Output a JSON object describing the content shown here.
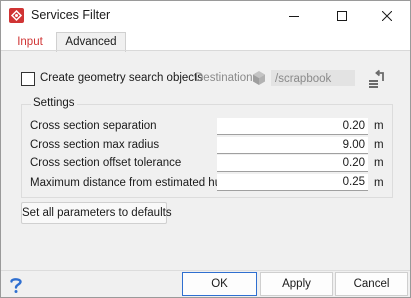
{
  "window": {
    "title": "Services Filter"
  },
  "tabs": [
    {
      "label": "Input"
    },
    {
      "label": "Advanced"
    }
  ],
  "geometry": {
    "checkbox_label": "Create geometry search objects",
    "destination_label": "Destination",
    "destination_value": "/scrapbook",
    "checked": false
  },
  "settings": {
    "title": "Settings",
    "params": [
      {
        "label": "Cross section separation",
        "value": "0.20",
        "unit": "m"
      },
      {
        "label": "Cross section max radius",
        "value": "9.00",
        "unit": "m"
      },
      {
        "label": "Cross section offset tolerance",
        "value": "0.20",
        "unit": "m"
      },
      {
        "label": "Maximum distance from estimated hull",
        "value": "0.25",
        "unit": "m"
      }
    ],
    "defaults_button": "Set all parameters to defaults"
  },
  "footer": {
    "ok": "OK",
    "apply": "Apply",
    "cancel": "Cancel"
  },
  "colors": {
    "accent": "#2f6fd0",
    "tab_active_input": "#d03434",
    "app_icon": "#d03434"
  }
}
